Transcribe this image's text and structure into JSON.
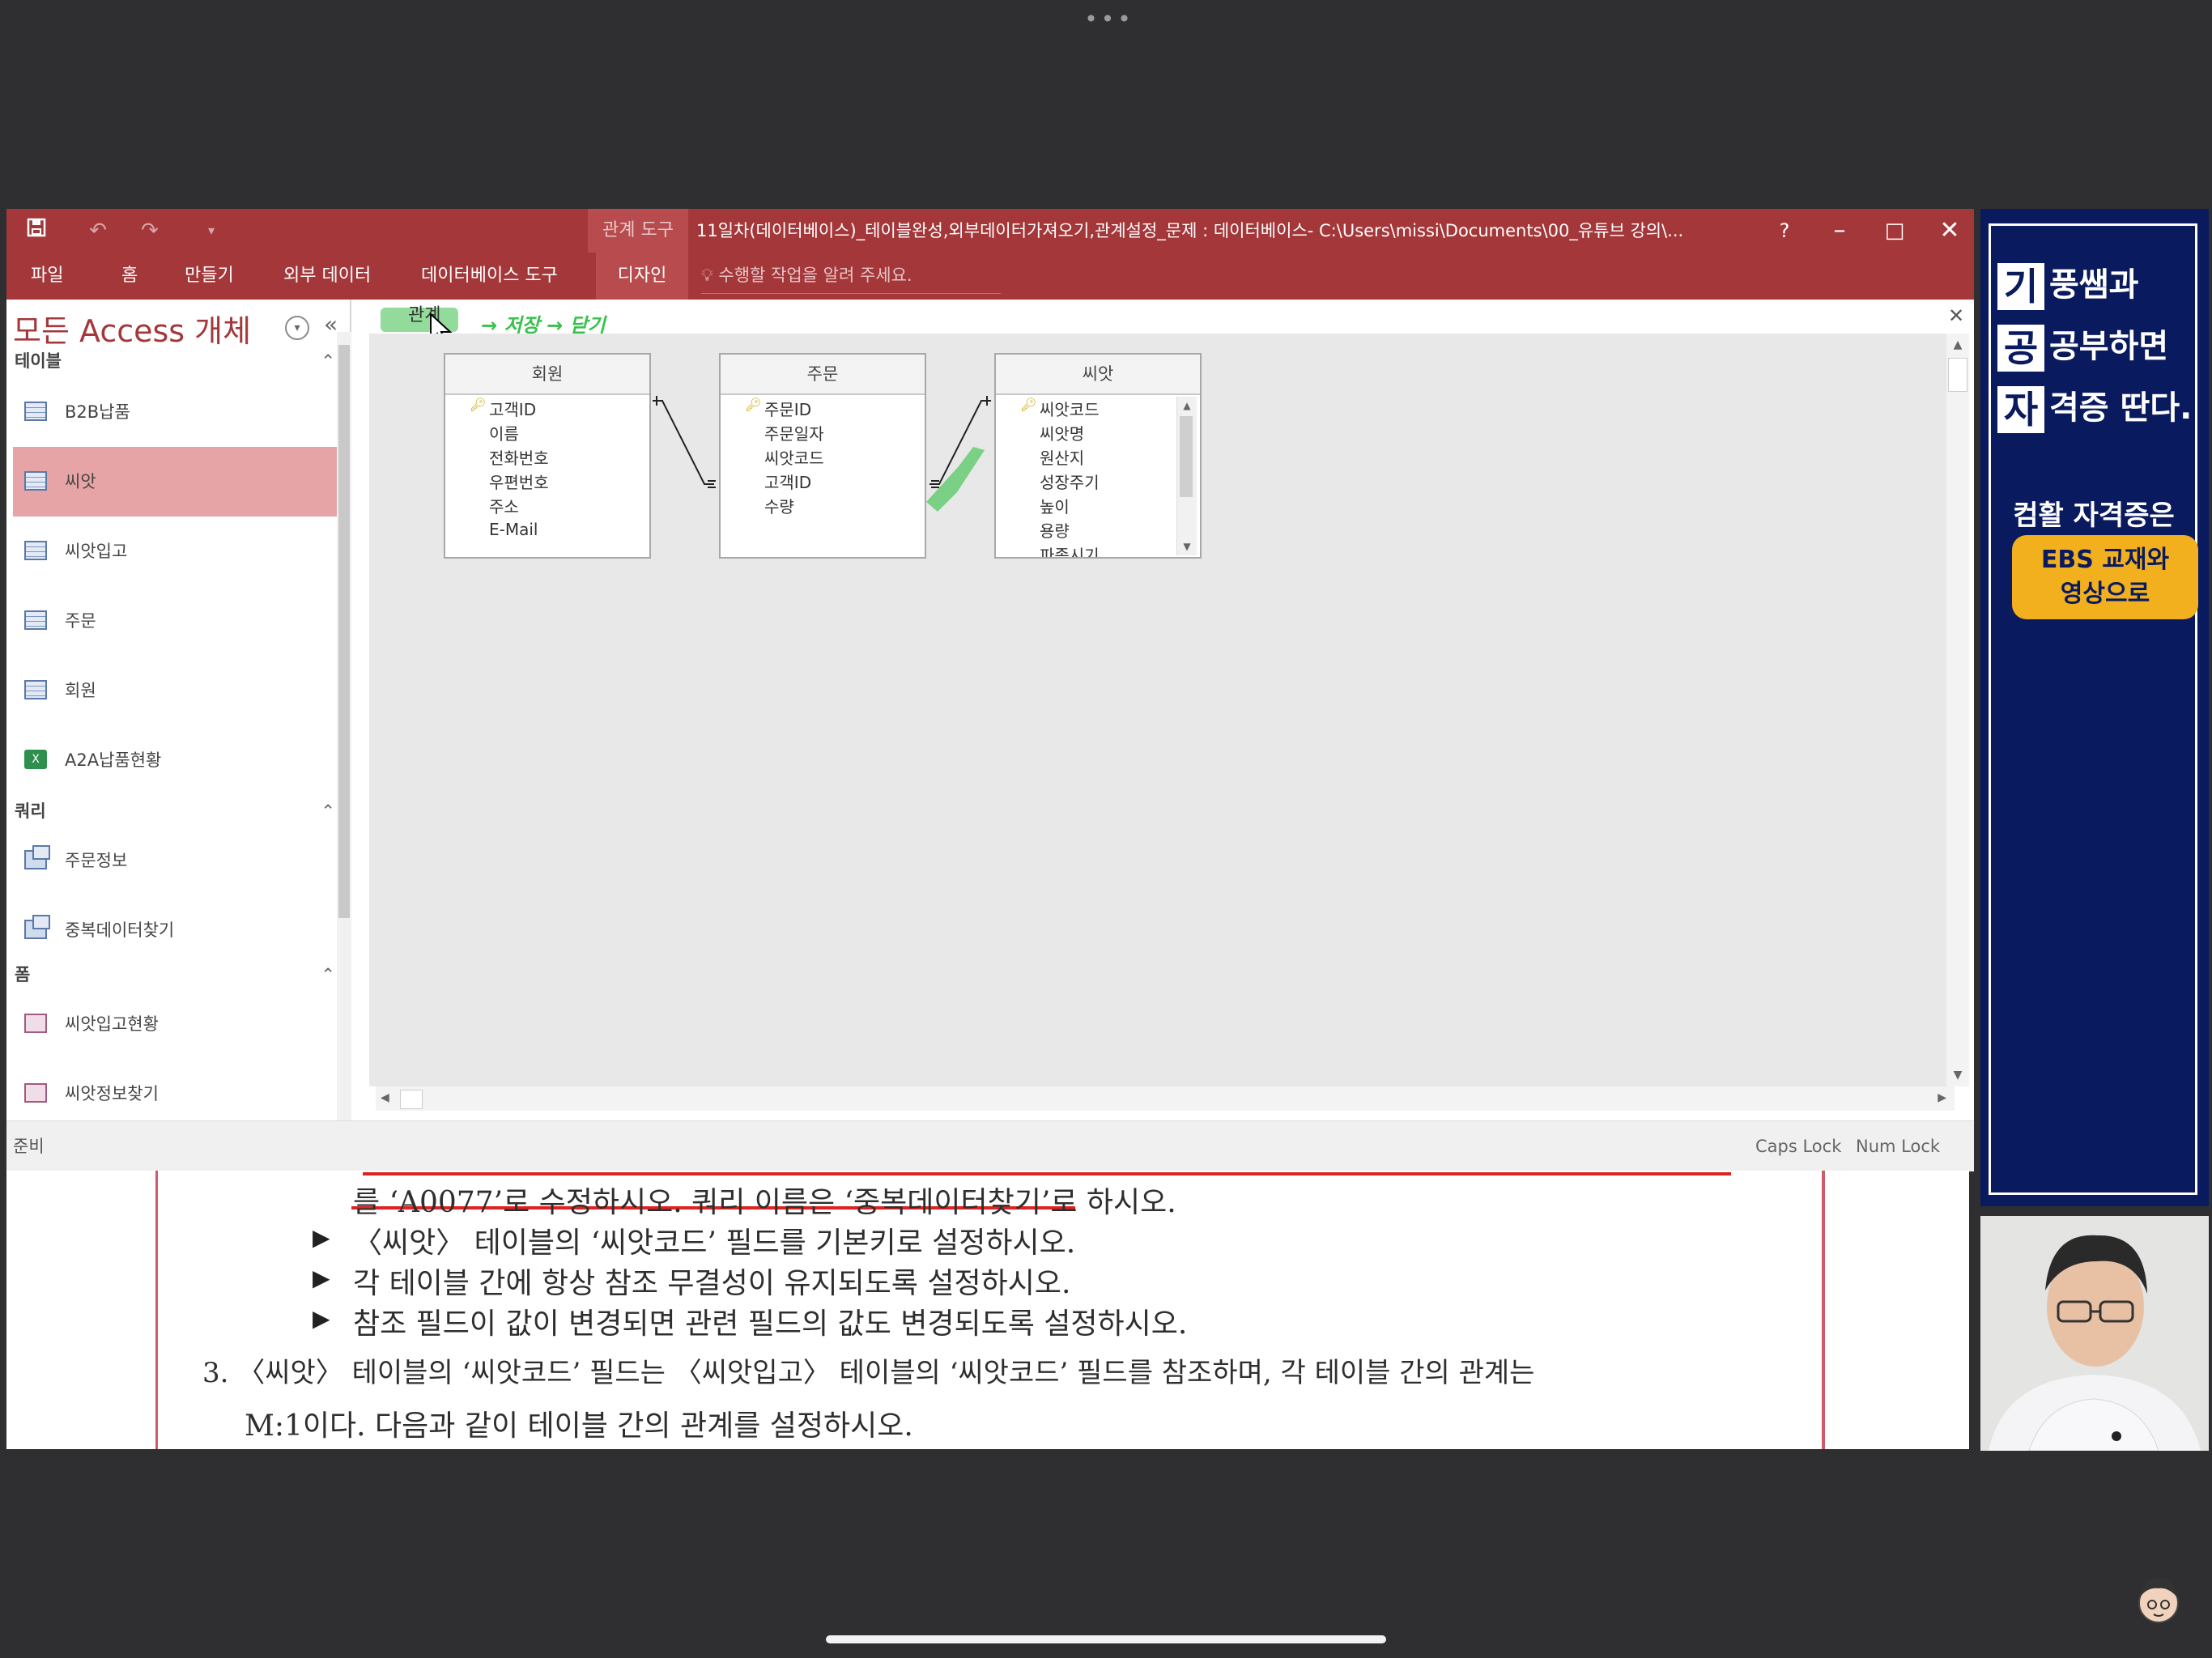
{
  "top_indicator": "•••",
  "titlebar": {
    "context_tools": "관계 도구",
    "document_title": "11일차(데이터베이스)_테이블완성,외부데이터가져오기,관계설정_문제 : 데이터베이스- C:\\Users\\missi\\Documents\\00_유튜브 강의\\...",
    "help": "?",
    "minimize": "–",
    "maximize": "□",
    "close": "✕"
  },
  "ribbon": {
    "tabs": [
      "파일",
      "홈",
      "만들기",
      "외부 데이터",
      "데이터베이스 도구",
      "디자인"
    ],
    "tell_me_placeholder": "수행할 작업을 알려 주세요."
  },
  "nav": {
    "title": "모든 Access 개체",
    "groups": {
      "tables": {
        "label": "테이블",
        "items": [
          "B2B납품",
          "씨앗",
          "씨앗입고",
          "주문",
          "회원",
          "A2A납품현황"
        ]
      },
      "queries": {
        "label": "쿼리",
        "items": [
          "주문정보",
          "중복데이터찾기"
        ]
      },
      "forms": {
        "label": "폼",
        "items": [
          "씨앗입고현황",
          "씨앗정보찾기"
        ]
      }
    },
    "selected_item": "씨앗"
  },
  "relationships": {
    "tab_label": "관계",
    "handwritten_note": "→ 저장 → 닫기",
    "tables": [
      {
        "name": "회원",
        "fields": [
          "고객ID",
          "이름",
          "전화번호",
          "우편번호",
          "주소",
          "E-Mail"
        ]
      },
      {
        "name": "주문",
        "fields": [
          "주문ID",
          "주문일자",
          "씨앗코드",
          "고객ID",
          "수량"
        ]
      },
      {
        "name": "씨앗",
        "fields": [
          "씨앗코드",
          "씨앗명",
          "원산지",
          "성장주기",
          "높이",
          "용량",
          "파종시기"
        ]
      }
    ]
  },
  "statusbar": {
    "status": "준비",
    "caps_lock": "Caps Lock",
    "num_lock": "Num Lock"
  },
  "document": {
    "line1": "를 ‘A0077’로 수정하시오. 쿼리 이름은 ‘중복데이터찾기’로 하시오.",
    "bullets": [
      "〈씨앗〉 테이블의 ‘씨앗코드’ 필드를 기본키로 설정하시오.",
      "각 테이블 간에 항상 참조 무결성이 유지되도록 설정하시오.",
      "참조 필드이 값이 변경되면 관련 필드의 값도 변경되도록 설정하시오."
    ],
    "item3": "3. 〈씨앗〉 테이블의 ‘씨앗코드’ 필드는 〈씨앗입고〉 테이블의 ‘씨앗코드’ 필드를 참조하며, 각 테이블 간의 관계는",
    "item3_cont": "M:1이다. 다음과 같이 테이블 간의 관계를 설정하시오.",
    "bullet_glyph": "▶"
  },
  "banner": {
    "rows": [
      {
        "box": "기",
        "text": "풍쌤과"
      },
      {
        "box": "공",
        "text": "공부하면"
      },
      {
        "box": "자",
        "text": "격증 딴다."
      }
    ],
    "promo": "컴활 자격증은",
    "ebs_line1": "EBS 교재와",
    "ebs_line2": "영상으로"
  },
  "colors": {
    "accent": "#a4373a",
    "selected": "#e6a4a6",
    "banner": "#0a1a5e",
    "ebs": "#f2b01e",
    "note": "#38c24d"
  }
}
